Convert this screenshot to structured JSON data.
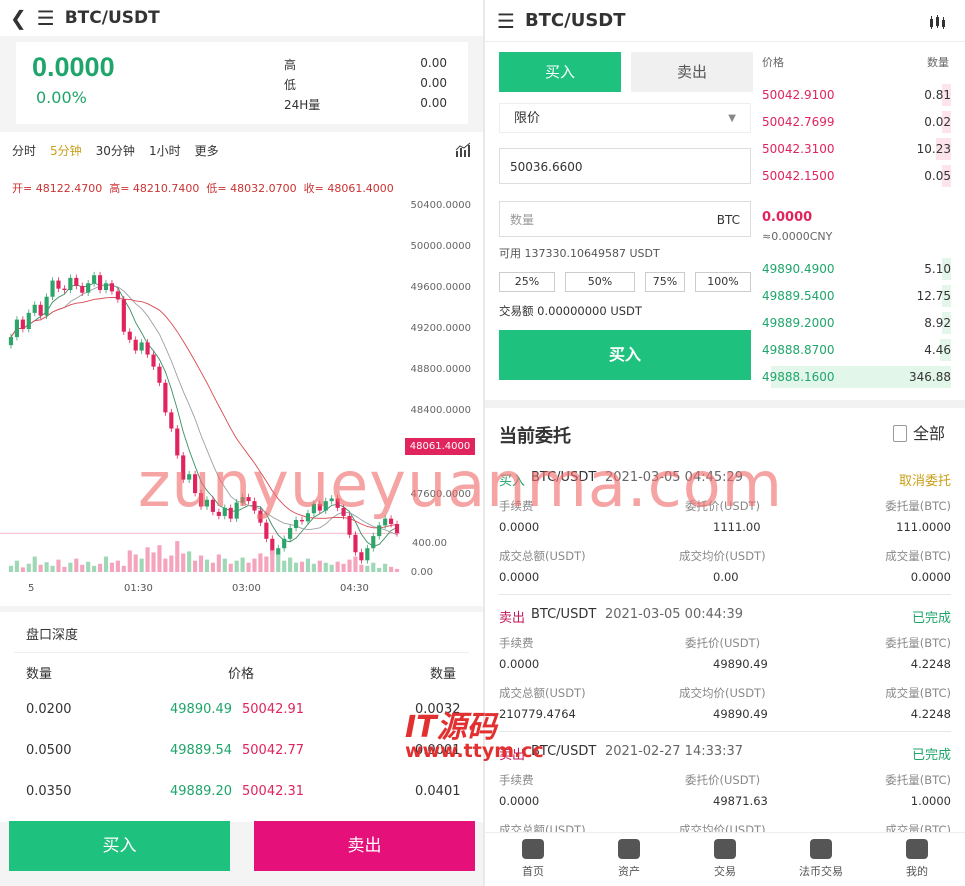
{
  "left": {
    "pair": "BTC/USDT",
    "price": "0.0000",
    "change": "0.00%",
    "stats": [
      {
        "label": "高",
        "value": "0.00"
      },
      {
        "label": "低",
        "value": "0.00"
      },
      {
        "label": "24H量",
        "value": "0.00"
      }
    ],
    "tabs": [
      "分时",
      "5分钟",
      "30分钟",
      "1小时",
      "更多"
    ],
    "active_tab": "5分钟",
    "ohlc": {
      "open": "开= 48122.4700",
      "high": "高= 48210.7400",
      "low": "低= 48032.0700",
      "close": "收= 48061.4000"
    },
    "last_price_tag": "48061.4000",
    "depth_title": "盘口深度",
    "depth_headers": [
      "数量",
      "价格",
      "数量"
    ],
    "depth_rows": [
      {
        "bq": "0.0200",
        "bp": "49890.49",
        "ap": "50042.91",
        "aq": "0.0032"
      },
      {
        "bq": "0.0500",
        "bp": "49889.54",
        "ap": "50042.77",
        "aq": "0.0001"
      },
      {
        "bq": "0.0350",
        "bp": "49889.20",
        "ap": "50042.31",
        "aq": "0.0401"
      }
    ],
    "buy": "买入",
    "sell": "卖出"
  },
  "chart_data": {
    "type": "candlestick",
    "y_ticks": [
      "50400.0000",
      "50000.0000",
      "49600.0000",
      "49200.0000",
      "48800.0000",
      "48400.0000",
      "48000.0000",
      "47600.0000"
    ],
    "volume_ticks": [
      "400.00",
      "0.00"
    ],
    "x_ticks": [
      "5",
      "01:30",
      "03:00",
      "04:30"
    ],
    "ylim": [
      47550,
      50450
    ],
    "close": [
      49520,
      49650,
      49580,
      49700,
      49760,
      49680,
      49820,
      49940,
      49880,
      49870,
      49960,
      49900,
      49850,
      49920,
      49980,
      49870,
      49920,
      49860,
      49800,
      49560,
      49500,
      49420,
      49480,
      49390,
      49300,
      49180,
      48960,
      48840,
      48640,
      48460,
      48500,
      48360,
      48260,
      48310,
      48220,
      48190,
      48250,
      48170,
      48290,
      48330,
      48300,
      48230,
      48140,
      48020,
      47900,
      47950,
      48020,
      48100,
      48160,
      48150,
      48210,
      48280,
      48230,
      48300,
      48320,
      48250,
      48190,
      48050,
      47920,
      47860,
      47950,
      48040,
      48120,
      48170,
      48130,
      48061
    ],
    "volume": [
      60,
      110,
      45,
      80,
      150,
      70,
      95,
      60,
      120,
      50,
      90,
      130,
      70,
      100,
      60,
      80,
      150,
      90,
      110,
      60,
      210,
      170,
      130,
      240,
      190,
      260,
      130,
      160,
      300,
      180,
      200,
      110,
      160,
      120,
      90,
      170,
      130,
      80,
      110,
      140,
      90,
      130,
      180,
      150,
      210,
      170,
      110,
      140,
      90,
      100,
      130,
      80,
      110,
      90,
      70,
      100,
      80,
      120,
      150,
      70,
      60,
      90,
      40,
      80,
      50,
      30
    ]
  },
  "right": {
    "pair": "BTC/USDT",
    "buy_tab": "买入",
    "sell_tab": "卖出",
    "order_type": "限价",
    "price_value": "50036.6600",
    "qty_placeholder": "数量",
    "qty_unit": "BTC",
    "available": "可用 137330.10649587 USDT",
    "percents": [
      "25%",
      "50%",
      "75%",
      "100%"
    ],
    "amount": "交易额 0.00000000 USDT",
    "submit": "买入",
    "book_header_price": "价格",
    "book_header_qty": "数量",
    "asks": [
      {
        "price": "50042.9100",
        "qty": "0.81",
        "depth": 0.05
      },
      {
        "price": "50042.7699",
        "qty": "0.02",
        "depth": 0.05
      },
      {
        "price": "50042.3100",
        "qty": "10.23",
        "depth": 0.08
      },
      {
        "price": "50042.1500",
        "qty": "0.05",
        "depth": 0.05
      }
    ],
    "last": "0.0000",
    "last_cny": "≈0.0000CNY",
    "bids": [
      {
        "price": "49890.4900",
        "qty": "5.10",
        "depth": 0.05
      },
      {
        "price": "49889.5400",
        "qty": "12.75",
        "depth": 0.05
      },
      {
        "price": "49889.2000",
        "qty": "8.92",
        "depth": 0.05
      },
      {
        "price": "49888.8700",
        "qty": "4.46",
        "depth": 0.06
      },
      {
        "price": "49888.1600",
        "qty": "346.88",
        "depth": 0.95
      }
    ],
    "orders_title": "当前委托",
    "orders_all": "全部",
    "orders": [
      {
        "side": "买入",
        "pair": "BTC/USDT",
        "time": "2021-03-05 04:45:29",
        "status": "取消委托",
        "fee_label": "手续费",
        "fee": "0.0000",
        "entrust_price_label": "委托价(USDT)",
        "entrust_price": "1111.00",
        "entrust_qty_label": "委托量(BTC)",
        "entrust_qty": "111.0000",
        "total_label": "成交总额(USDT)",
        "total": "0.0000",
        "avg_label": "成交均价(USDT)",
        "avg": "0.00",
        "filled_label": "成交量(BTC)",
        "filled": "0.0000"
      },
      {
        "side": "卖出",
        "pair": "BTC/USDT",
        "time": "2021-03-05 00:44:39",
        "status": "已完成",
        "fee_label": "手续费",
        "fee": "0.0000",
        "entrust_price_label": "委托价(USDT)",
        "entrust_price": "49890.49",
        "entrust_qty_label": "委托量(BTC)",
        "entrust_qty": "4.2248",
        "total_label": "成交总额(USDT)",
        "total": "210779.4764",
        "avg_label": "成交均价(USDT)",
        "avg": "49890.49",
        "filled_label": "成交量(BTC)",
        "filled": "4.2248"
      },
      {
        "side": "卖出",
        "pair": "BTC/USDT",
        "time": "2021-02-27 14:33:37",
        "status": "已完成",
        "fee_label": "手续费",
        "fee": "0.0000",
        "entrust_price_label": "委托价(USDT)",
        "entrust_price": "49871.63",
        "entrust_qty_label": "委托量(BTC)",
        "entrust_qty": "1.0000",
        "total_label": "成交总额(USDT)",
        "total": "",
        "avg_label": "成交均价(USDT)",
        "avg": "",
        "filled_label": "成交量(BTC)",
        "filled": ""
      }
    ],
    "nav": [
      "首页",
      "资产",
      "交易",
      "法币交易",
      "我的"
    ]
  },
  "watermark": {
    "main": "zunyueyuanma.com",
    "logo": "IT源码",
    "url": "www.ttym.cc"
  },
  "colors": {
    "up": "#1fa56b",
    "down": "#e0245e",
    "buy_btn": "#1ec17e",
    "sell_btn": "#e5107a"
  }
}
